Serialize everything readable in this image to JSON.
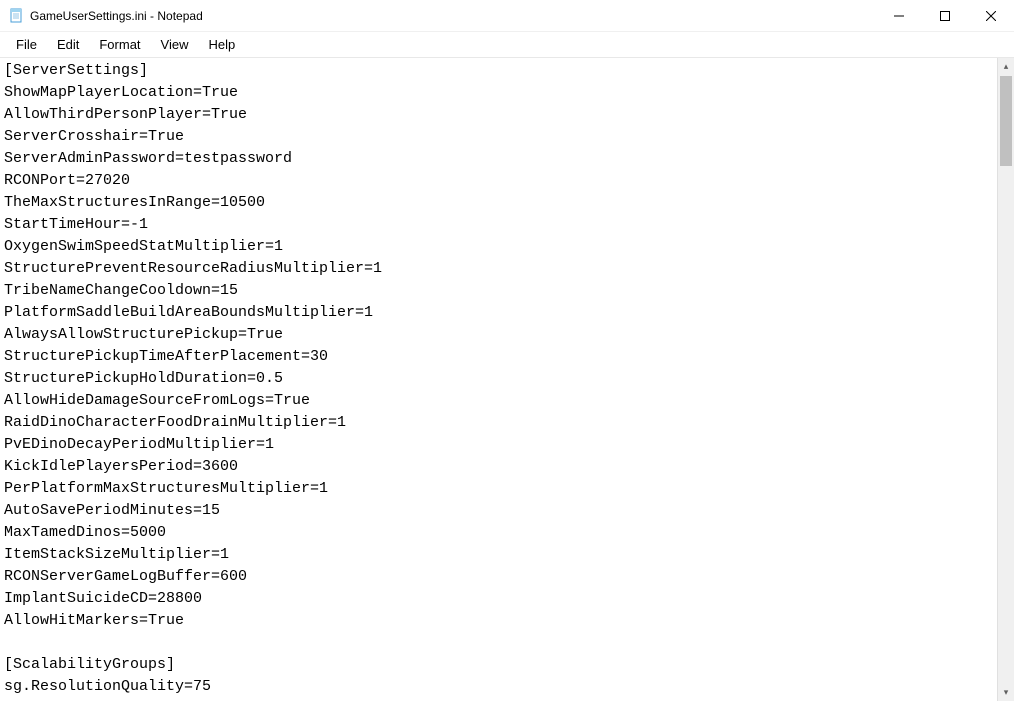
{
  "titlebar": {
    "title": "GameUserSettings.ini - Notepad"
  },
  "menubar": {
    "file": "File",
    "edit": "Edit",
    "format": "Format",
    "view": "View",
    "help": "Help"
  },
  "editor": {
    "content": "[ServerSettings]\nShowMapPlayerLocation=True\nAllowThirdPersonPlayer=True\nServerCrosshair=True\nServerAdminPassword=testpassword\nRCONPort=27020\nTheMaxStructuresInRange=10500\nStartTimeHour=-1\nOxygenSwimSpeedStatMultiplier=1\nStructurePreventResourceRadiusMultiplier=1\nTribeNameChangeCooldown=15\nPlatformSaddleBuildAreaBoundsMultiplier=1\nAlwaysAllowStructurePickup=True\nStructurePickupTimeAfterPlacement=30\nStructurePickupHoldDuration=0.5\nAllowHideDamageSourceFromLogs=True\nRaidDinoCharacterFoodDrainMultiplier=1\nPvEDinoDecayPeriodMultiplier=1\nKickIdlePlayersPeriod=3600\nPerPlatformMaxStructuresMultiplier=1\nAutoSavePeriodMinutes=15\nMaxTamedDinos=5000\nItemStackSizeMultiplier=1\nRCONServerGameLogBuffer=600\nImplantSuicideCD=28800\nAllowHitMarkers=True\n\n[ScalabilityGroups]\nsg.ResolutionQuality=75"
  }
}
